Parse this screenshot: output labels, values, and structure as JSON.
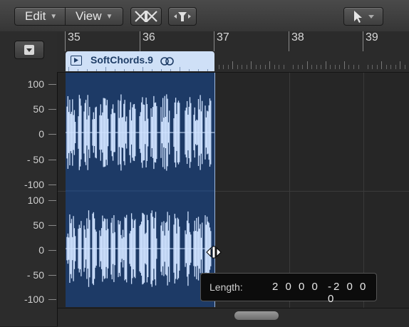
{
  "toolbar": {
    "edit_label": "Edit",
    "view_label": "View",
    "icons": [
      "catch-playhead-icon",
      "snap-icon",
      "pointer-tool-icon"
    ]
  },
  "ruler": {
    "bars": [
      "35",
      "36",
      "37",
      "38",
      "39"
    ]
  },
  "region": {
    "name": "SoftChords.9",
    "color": "#1d3a66",
    "header_color": "#cfe0f7"
  },
  "amplitude_scale": {
    "upper": [
      "100",
      "50",
      "0",
      "- 50",
      "-100"
    ],
    "lower": [
      "100",
      "50",
      "0",
      "- 50",
      "-100"
    ]
  },
  "tooltip": {
    "label": "Length:",
    "value1": "2 0 0 0",
    "value2": "-2 0 0 0"
  }
}
